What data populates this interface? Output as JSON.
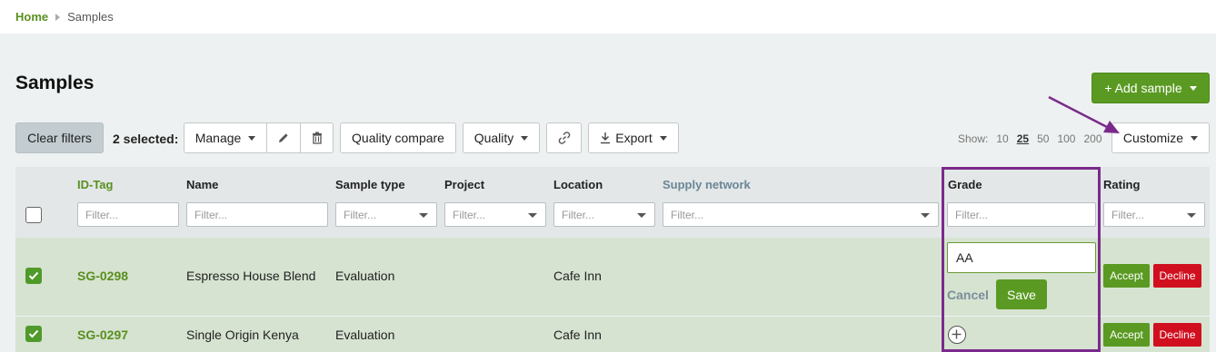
{
  "breadcrumb": {
    "home": "Home",
    "current": "Samples"
  },
  "page": {
    "title": "Samples"
  },
  "toolbar": {
    "add_sample": "+ Add sample",
    "clear_filters": "Clear filters",
    "selected": "2 selected:",
    "manage": "Manage",
    "quality_compare": "Quality compare",
    "quality": "Quality",
    "export": "Export",
    "customize": "Customize",
    "show_label": "Show:",
    "show_options": [
      "10",
      "25",
      "50",
      "100",
      "200"
    ],
    "show_active": "25"
  },
  "table": {
    "headers": [
      "ID-Tag",
      "Name",
      "Sample type",
      "Project",
      "Location",
      "Supply network",
      "Grade",
      "Rating"
    ],
    "filter_placeholder": "Filter...",
    "rows": [
      {
        "id": "SG-0298",
        "name": "Espresso House Blend",
        "type": "Evaluation",
        "project": "",
        "location": "Cafe Inn",
        "grade_value": "AA",
        "checked": true
      },
      {
        "id": "SG-0297",
        "name": "Single Origin Kenya",
        "type": "Evaluation",
        "project": "",
        "location": "Cafe Inn",
        "checked": true
      }
    ],
    "grade_edit": {
      "cancel": "Cancel",
      "save": "Save"
    },
    "rating": {
      "accept": "Accept",
      "decline": "Decline"
    }
  },
  "colors": {
    "accent": "#5a9a22",
    "danger": "#d0101f",
    "highlight": "#7b2a8c"
  }
}
